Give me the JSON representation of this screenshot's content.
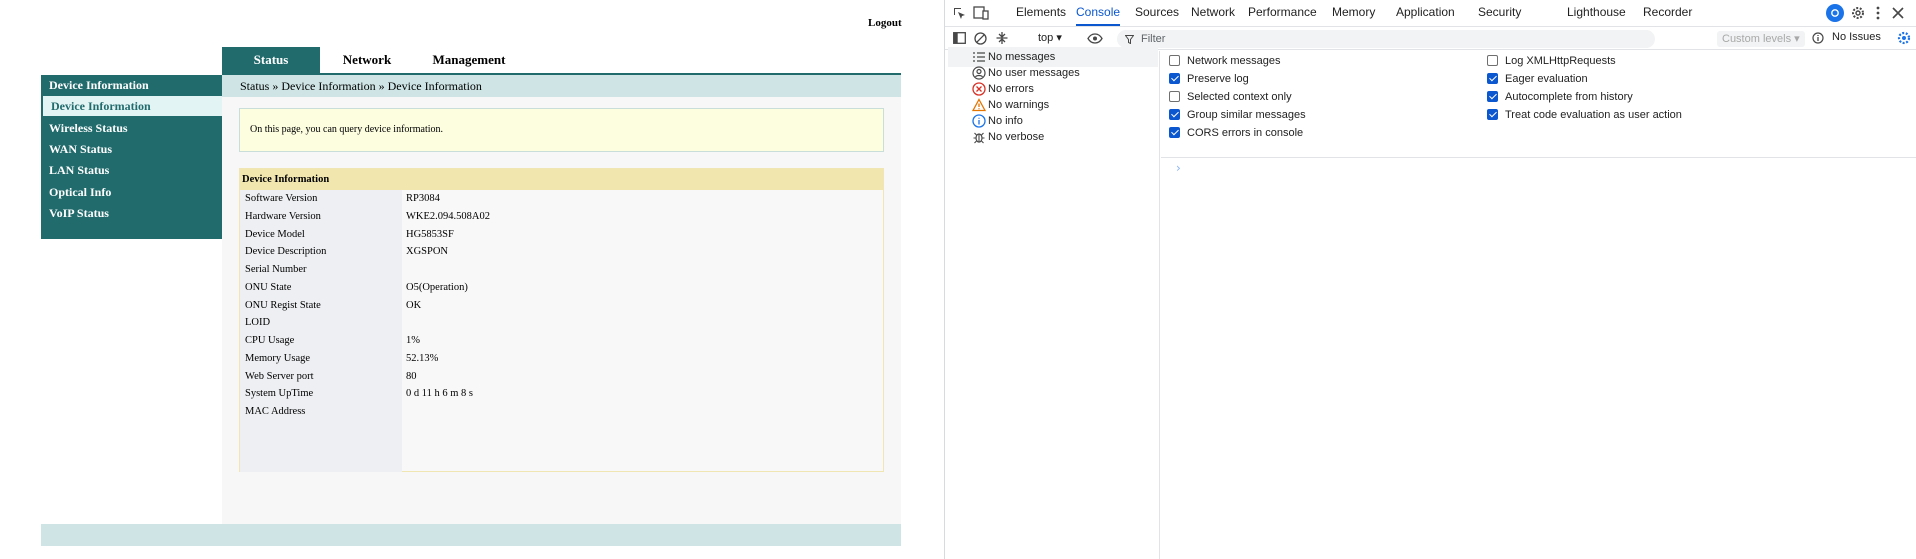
{
  "router": {
    "logout": "Logout",
    "tabs": [
      "Status",
      "Network",
      "Management"
    ],
    "sidebar": {
      "section": "Device Information",
      "active_item": "Device Information",
      "items": [
        "Wireless Status",
        "WAN Status",
        "LAN Status",
        "Optical Info",
        "VoIP Status"
      ]
    },
    "breadcrumb": [
      "Status",
      "Device Information",
      "Device Information"
    ],
    "breadcrumb_sep": "»",
    "info_text": "On this page, you can query device information.",
    "table_title": "Device Information",
    "rows": [
      {
        "label": "Software Version",
        "value": "RP3084"
      },
      {
        "label": "Hardware Version",
        "value": "WKE2.094.508A02"
      },
      {
        "label": "Device Model",
        "value": "HG5853SF"
      },
      {
        "label": "Device Description",
        "value": "XGSPON"
      },
      {
        "label": "Serial Number",
        "value": ""
      },
      {
        "label": "ONU State",
        "value": "O5(Operation)"
      },
      {
        "label": "ONU Regist State",
        "value": "OK"
      },
      {
        "label": "LOID",
        "value": ""
      },
      {
        "label": "CPU Usage",
        "value": "1%"
      },
      {
        "label": "Memory Usage",
        "value": "52.13%"
      },
      {
        "label": "Web Server port",
        "value": "80"
      },
      {
        "label": "System UpTime",
        "value": "0 d 11 h 6 m 8 s"
      },
      {
        "label": "MAC Address",
        "value": ""
      }
    ],
    "colors": {
      "primary": "#216b6d",
      "breadcrumb_bg": "#cfe5e5",
      "active_sub_bg": "#e3f4f4",
      "info_bg": "#fdfde0",
      "table_head": "#f1e7ae"
    }
  },
  "devtools": {
    "tabs": [
      "Elements",
      "Console",
      "Sources",
      "Network",
      "Performance",
      "Memory",
      "Application",
      "Security",
      "Lighthouse",
      "Recorder"
    ],
    "active_tab": "Console",
    "toolbar": {
      "context": "top",
      "filter_placeholder": "Filter",
      "levels": "Custom levels",
      "issues": "No Issues"
    },
    "message_filters": [
      {
        "label": "No messages",
        "icon": "list-icon"
      },
      {
        "label": "No user messages",
        "icon": "user-icon"
      },
      {
        "label": "No errors",
        "icon": "error-icon"
      },
      {
        "label": "No warnings",
        "icon": "warning-icon"
      },
      {
        "label": "No info",
        "icon": "info-icon"
      },
      {
        "label": "No verbose",
        "icon": "bug-icon"
      }
    ],
    "settings_left": [
      {
        "label": "Network messages",
        "checked": false
      },
      {
        "label": "Preserve log",
        "checked": true
      },
      {
        "label": "Selected context only",
        "checked": false
      },
      {
        "label": "Group similar messages",
        "checked": true
      },
      {
        "label": "CORS errors in console",
        "checked": true
      }
    ],
    "settings_right": [
      {
        "label": "Log XMLHttpRequests",
        "checked": false
      },
      {
        "label": "Eager evaluation",
        "checked": true
      },
      {
        "label": "Autocomplete from history",
        "checked": true
      },
      {
        "label": "Treat code evaluation as user action",
        "checked": true
      }
    ],
    "prompt_symbol": "›",
    "colors": {
      "accent": "#0b57d0",
      "error": "#d93025",
      "warning": "#e37400"
    }
  }
}
